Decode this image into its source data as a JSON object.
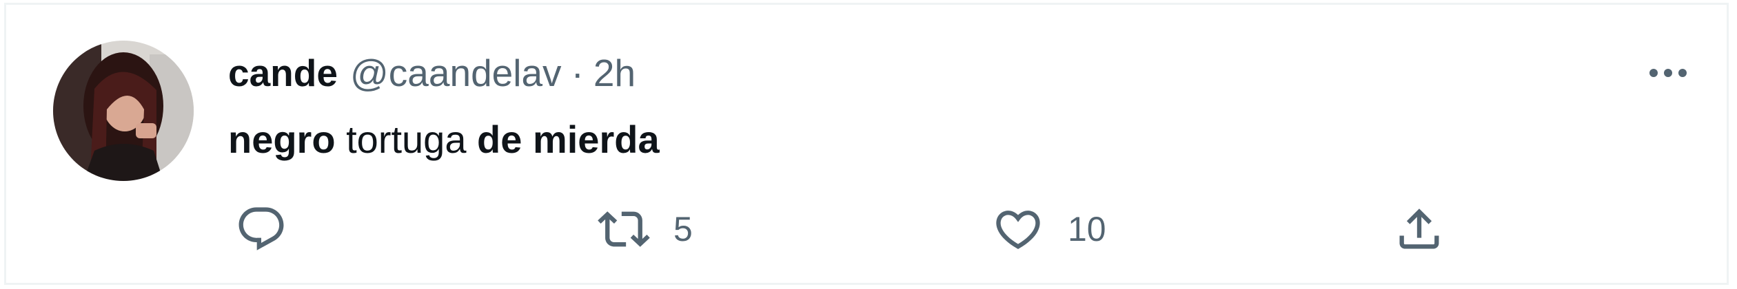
{
  "tweet": {
    "author": {
      "display_name": "cande",
      "handle": "@caandelav",
      "separator": "·",
      "time": "2h"
    },
    "text": {
      "part1": "negro",
      "part2": " tortuga ",
      "part3": "de mierda"
    },
    "actions": {
      "reply_icon": "speech-bubble-icon",
      "retweet_icon": "retweet-arrows-icon",
      "retweet_count": "5",
      "like_icon": "heart-icon",
      "like_count": "10",
      "share_icon": "share-upload-icon",
      "more_icon": "more-horizontal-icon"
    },
    "colors": {
      "text_primary": "#0f1419",
      "text_secondary": "#536471",
      "border": "#eff3f4"
    }
  }
}
